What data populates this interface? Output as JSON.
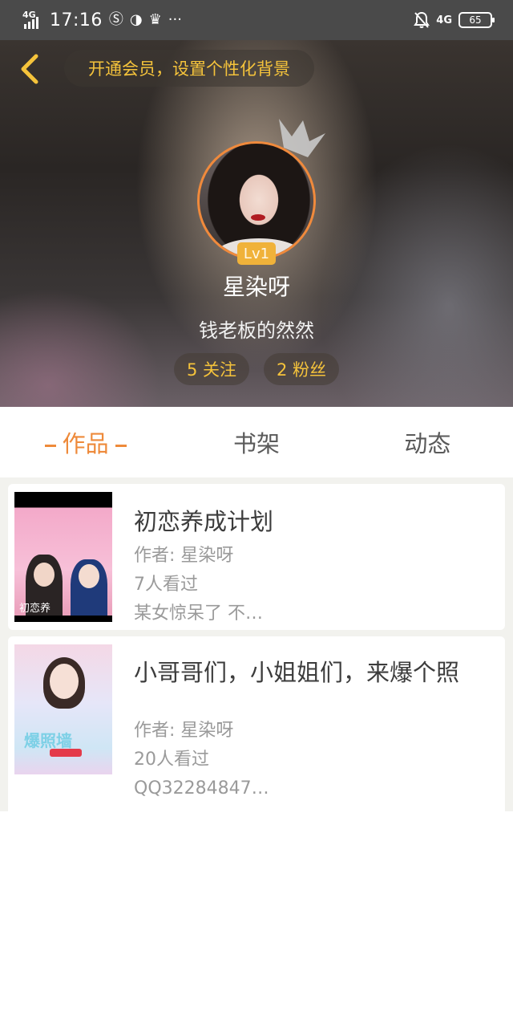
{
  "status_bar": {
    "network": "4G",
    "time": "17:16",
    "right_network": "4G",
    "battery": "65",
    "icons": [
      "signal-icon",
      "sim-icon",
      "pepsi-icon",
      "crown-icon",
      "more-dots-icon",
      "mute-bell-icon",
      "battery-icon"
    ],
    "more": "···"
  },
  "header": {
    "vip_banner": "开通会员，设置个性化背景",
    "level": "Lv1",
    "nickname": "星染呀",
    "signature": "钱老板的然然",
    "following": "5 关注",
    "followers": "2 粉丝",
    "accent_color": "#f5c33b"
  },
  "tabs": {
    "works": "作品",
    "bookshelf": "书架",
    "activity": "动态",
    "active_color": "#ee8a3a"
  },
  "works": [
    {
      "title": "初恋养成计划",
      "author": "作者: 星染呀",
      "views": "7人看过",
      "excerpt": "某女惊呆了 不…",
      "cover_text": "初恋养"
    },
    {
      "title": "小哥哥们，小姐姐们，来爆个照",
      "author": "作者: 星染呀",
      "views": "20人看过",
      "excerpt": "QQ32284847…",
      "cover_text": "爆照墙"
    }
  ]
}
